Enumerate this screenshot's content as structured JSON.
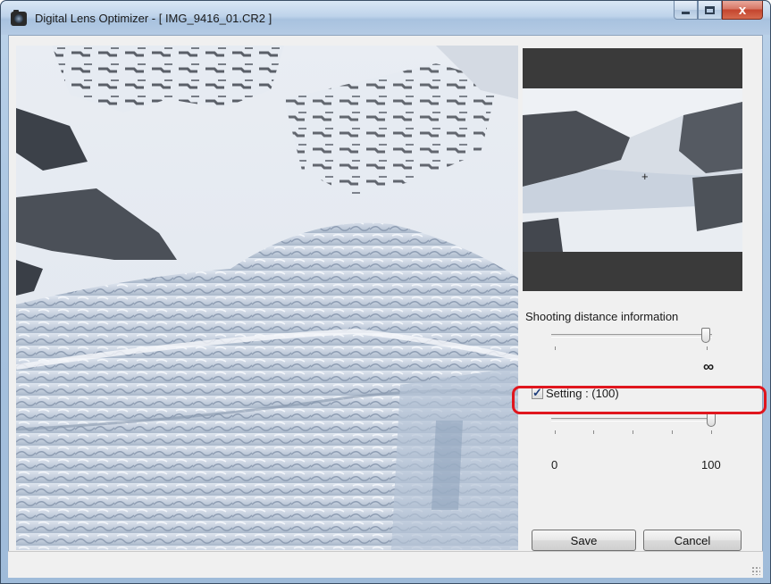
{
  "window": {
    "title_app": "Digital Lens Optimizer",
    "title_sep": " - ",
    "title_file": "[ IMG_9416_01.CR2 ]",
    "minimize_icon": "minimize-icon",
    "maximize_icon": "maximize-icon",
    "close_glyph": "x"
  },
  "panel": {
    "shooting_distance_label": "Shooting distance information",
    "shooting_distance_value_label": "∞",
    "setting_label": "Setting : (100)",
    "setting_checked": true,
    "setting_min_label": "0",
    "setting_max_label": "100",
    "setting_level_percent": 100
  },
  "buttons": {
    "save": "Save",
    "cancel": "Cancel"
  },
  "colors": {
    "highlight": "#e0161e",
    "nav_background": "#3a3a3a"
  }
}
